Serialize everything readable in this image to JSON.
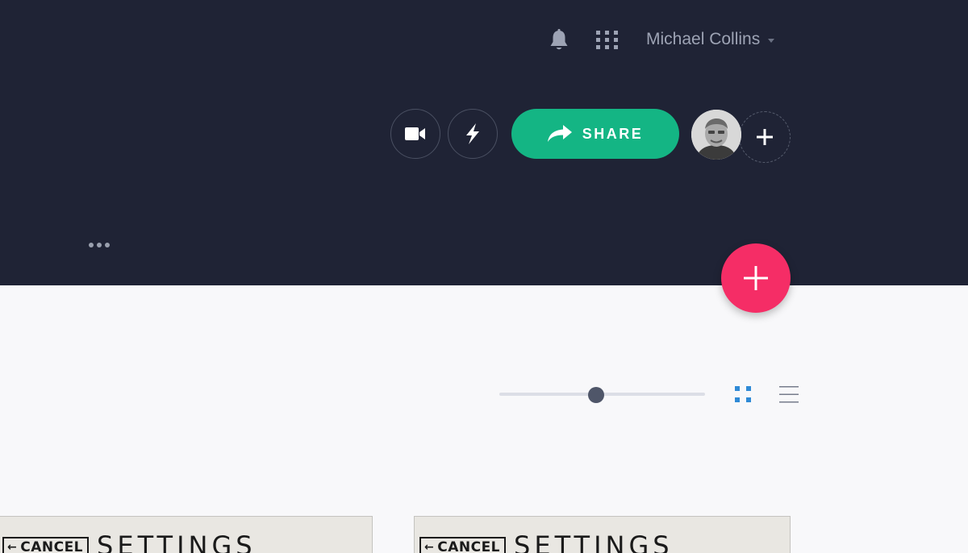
{
  "header": {
    "user_name": "Michael Collins",
    "share_label": "SHARE",
    "icons": [
      "bell-icon",
      "apps-grid-icon",
      "video-camera-icon",
      "lightning-bolt-icon",
      "share-arrow-icon",
      "plus-icon",
      "more-dots-icon"
    ],
    "colors": {
      "header_bg": "#1f2335",
      "share_green": "#14b584",
      "fab_pink": "#f52d66"
    }
  },
  "toolbar": {
    "zoom_level": 0.47,
    "active_view": "grid",
    "colors": {
      "active_icon": "#2f8ad6",
      "inactive_icon": "#767c8c"
    }
  },
  "screens": [
    {
      "cancel_label": "CANCEL",
      "title": "SETTINGS"
    },
    {
      "cancel_label": "CANCEL",
      "title": "SETTINGS"
    }
  ]
}
